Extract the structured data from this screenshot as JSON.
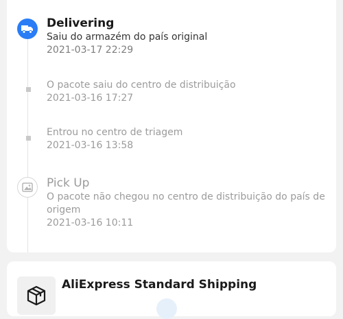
{
  "timeline": {
    "events": [
      {
        "title": "Delivering",
        "description": "Saiu do armazém do país original",
        "time": "2021-03-17 22:29",
        "icon": "delivery-truck-icon",
        "active": true
      },
      {
        "title": "",
        "description": "O pacote saiu do centro de distribuição",
        "time": "2021-03-16 17:27",
        "icon": "timeline-dot-icon",
        "active": false
      },
      {
        "title": "",
        "description": "Entrou no centro de triagem",
        "time": "2021-03-16 13:58",
        "icon": "timeline-dot-icon",
        "active": false
      },
      {
        "title": "Pick Up",
        "description": "O pacote não chegou no centro de distribuição do país de origem",
        "time": "2021-03-16 10:11",
        "icon": "pickup-image-icon",
        "active": false
      }
    ]
  },
  "shipping": {
    "method": "AliExpress Standard Shipping",
    "icon": "package-box-icon"
  },
  "colors": {
    "accent": "#2a7df5",
    "muted_text": "#9b9b9b"
  }
}
